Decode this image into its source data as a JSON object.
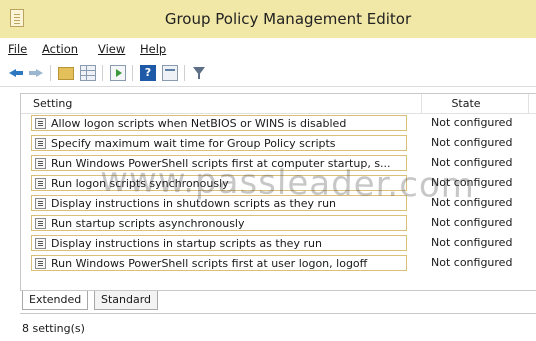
{
  "window": {
    "title": "Group Policy Management Editor",
    "title_bar_color": "#f1e7a7",
    "app_icon": "policy-editor-icon"
  },
  "menu": {
    "file": "File",
    "action": "Action",
    "view": "View",
    "help": "Help"
  },
  "toolbar": {
    "buttons": [
      "back-arrow-icon",
      "forward-arrow-icon",
      "up-folder-icon",
      "show-hide-tree-icon",
      "export-list-icon",
      "help-icon",
      "properties-icon",
      "filter-icon"
    ]
  },
  "table": {
    "columns": {
      "setting": "Setting",
      "state": "State"
    },
    "rows": [
      {
        "setting": "Allow logon scripts when NetBIOS or WINS is disabled",
        "state": "Not configured"
      },
      {
        "setting": "Specify maximum wait time for Group Policy scripts",
        "state": "Not configured"
      },
      {
        "setting": "Run Windows PowerShell scripts first at computer startup, s...",
        "state": "Not configured"
      },
      {
        "setting": "Run logon scripts synchronously",
        "state": "Not configured"
      },
      {
        "setting": "Display instructions in shutdown scripts as they run",
        "state": "Not configured"
      },
      {
        "setting": "Run startup scripts asynchronously",
        "state": "Not configured"
      },
      {
        "setting": "Display instructions in startup scripts as they run",
        "state": "Not configured"
      },
      {
        "setting": "Run Windows PowerShell scripts first at user logon, logoff",
        "state": "Not configured"
      }
    ]
  },
  "watermark": "www.passleader.com",
  "tabs": {
    "extended": "Extended",
    "standard": "Standard"
  },
  "status": {
    "text": "8 setting(s)"
  }
}
